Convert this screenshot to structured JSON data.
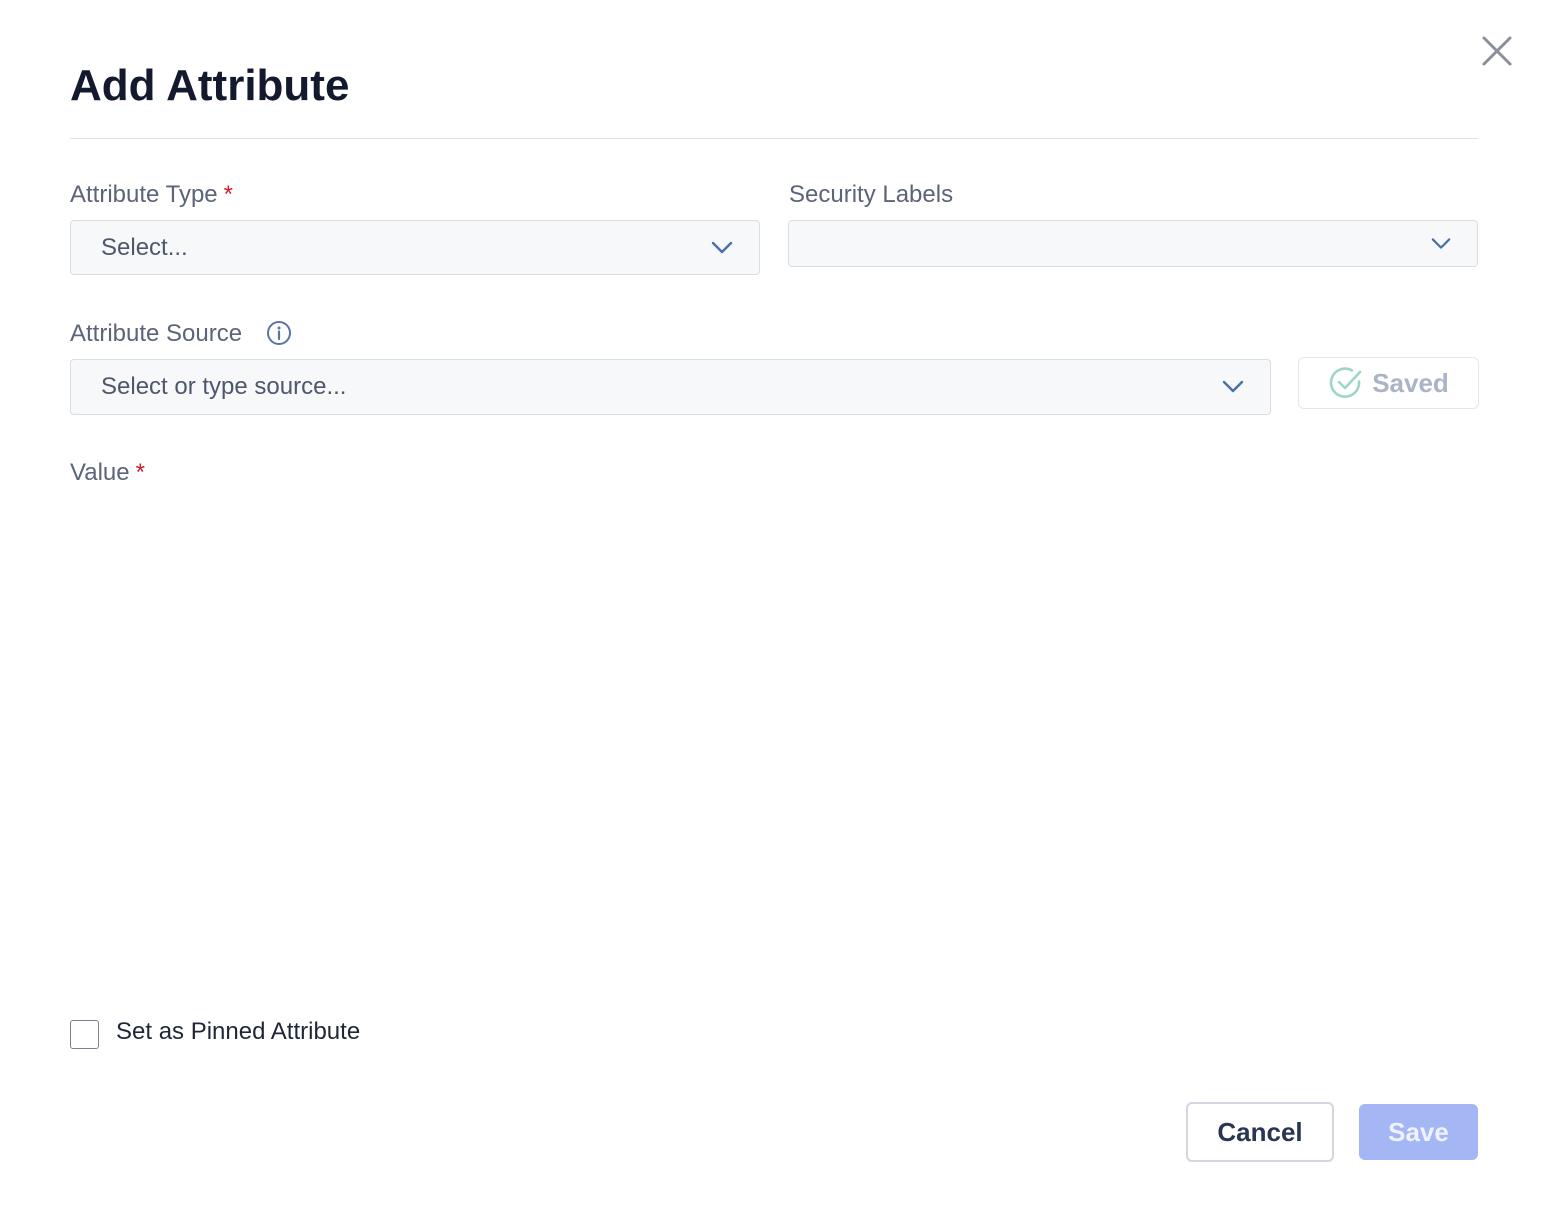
{
  "dialog": {
    "title": "Add Attribute"
  },
  "attribute_type": {
    "label": "Attribute Type",
    "required_mark": "*",
    "placeholder": "Select..."
  },
  "security_labels": {
    "label": "Security Labels",
    "value": ""
  },
  "attribute_source": {
    "label": "Attribute Source",
    "placeholder": "Select or type source..."
  },
  "saved_status": {
    "label": "Saved"
  },
  "value_field": {
    "label": "Value",
    "required_mark": "*"
  },
  "pinned": {
    "label": "Set as Pinned Attribute",
    "checked": false
  },
  "footer": {
    "cancel_label": "Cancel",
    "save_label": "Save"
  },
  "colors": {
    "primary_disabled": "#a4b6f3",
    "required": "#d11a2a",
    "saved_check": "#9fd6c2"
  },
  "icons": {
    "close": "close-icon",
    "chevron": "chevron-down-icon",
    "info": "info-icon",
    "saved": "check-circle-icon"
  }
}
